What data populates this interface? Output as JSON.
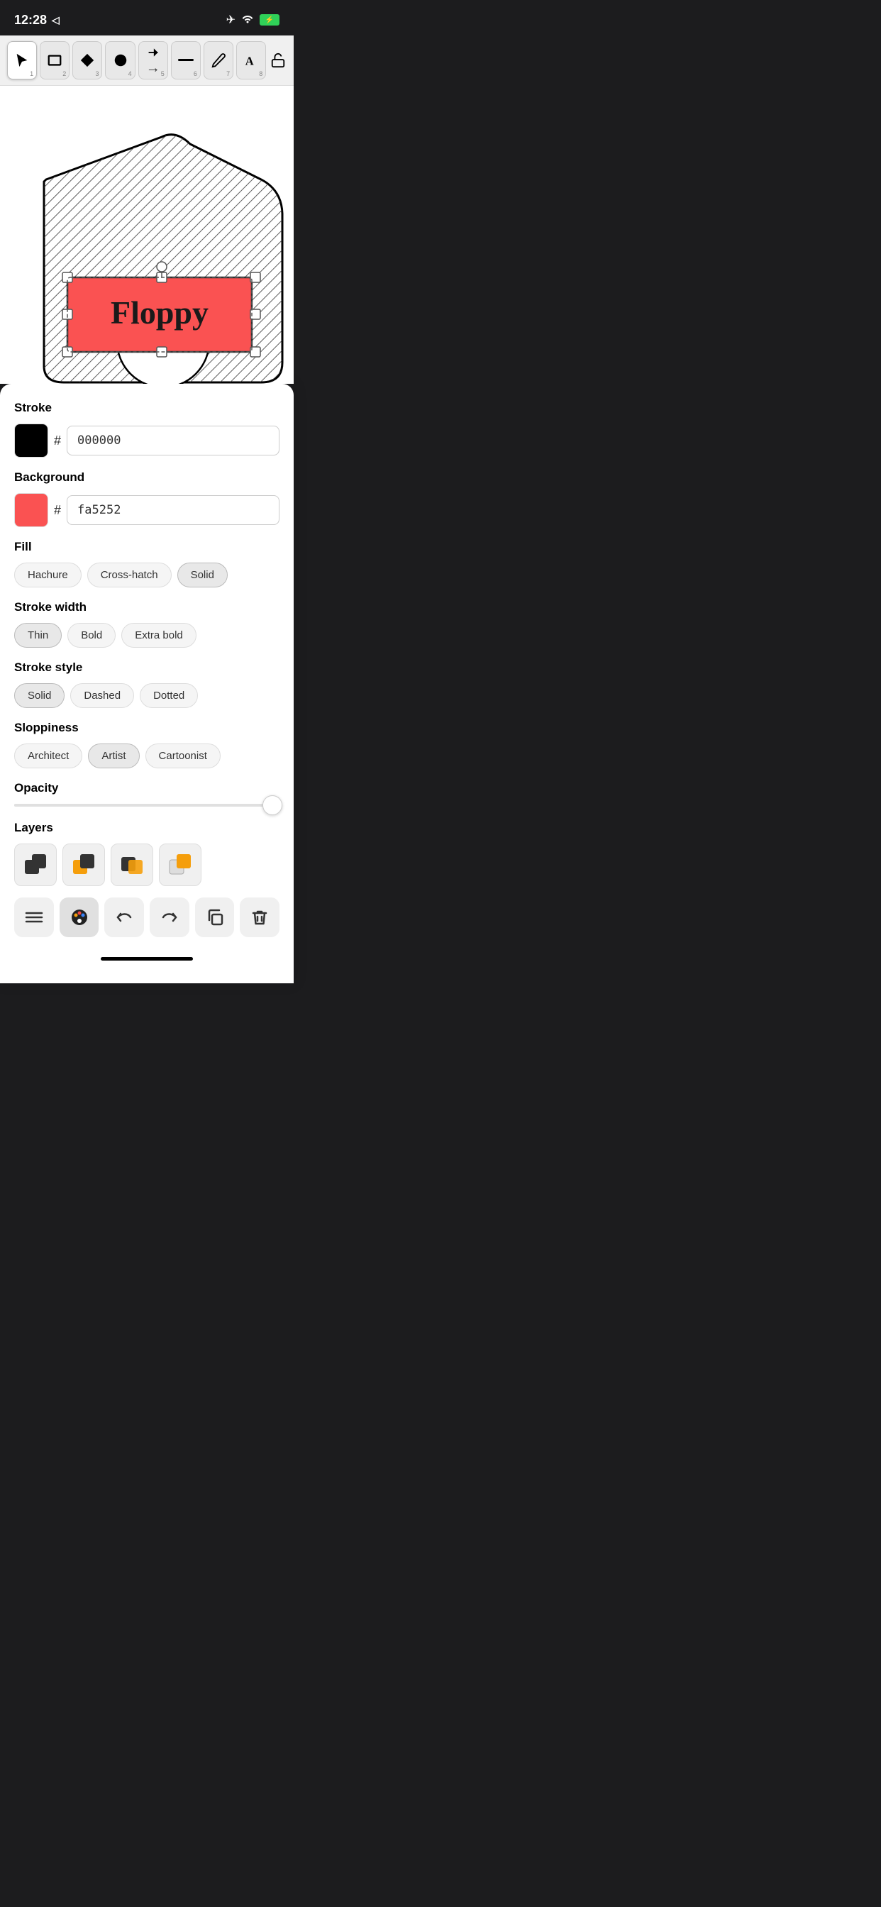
{
  "statusBar": {
    "time": "12:28",
    "locationArrow": "▶",
    "airplane": "✈",
    "wifi": "wifi",
    "battery": "⚡"
  },
  "toolbar": {
    "tools": [
      {
        "id": 1,
        "icon": "cursor",
        "label": "1",
        "active": true
      },
      {
        "id": 2,
        "icon": "rect",
        "label": "2",
        "active": false
      },
      {
        "id": 3,
        "icon": "diamond",
        "label": "3",
        "active": false
      },
      {
        "id": 4,
        "icon": "circle",
        "label": "4",
        "active": false
      },
      {
        "id": 5,
        "icon": "arrow",
        "label": "5",
        "active": false
      },
      {
        "id": 6,
        "icon": "line",
        "label": "6",
        "active": false
      },
      {
        "id": 7,
        "icon": "pencil",
        "label": "7",
        "active": false
      },
      {
        "id": 8,
        "icon": "text",
        "label": "8",
        "active": false
      }
    ],
    "lockIcon": "🔓"
  },
  "properties": {
    "strokeLabel": "Stroke",
    "strokeColor": "000000",
    "strokeSwatch": "#000000",
    "backgroundLabel": "Background",
    "backgroundColor": "fa5252",
    "backgroundSwatch": "#fa5252",
    "fillLabel": "Fill",
    "fillOptions": [
      "Hachure",
      "Cross-hatch",
      "Solid"
    ],
    "fillActive": "Solid",
    "strokeWidthLabel": "Stroke width",
    "strokeWidthOptions": [
      "Thin",
      "Bold",
      "Extra bold"
    ],
    "strokeWidthActive": "Thin",
    "strokeStyleLabel": "Stroke style",
    "strokeStyleOptions": [
      "Solid",
      "Dashed",
      "Dotted"
    ],
    "strokeStyleActive": "Solid",
    "sloppinessLabel": "Sloppiness",
    "sloppinessOptions": [
      "Architect",
      "Artist",
      "Cartoonist"
    ],
    "sloppinessActive": "Artist",
    "opacityLabel": "Opacity",
    "opacityValue": 95,
    "layersLabel": "Layers"
  },
  "bottomActions": {
    "menu": "≡",
    "palette": "🎨",
    "undo": "↩",
    "redo": "↪",
    "copy": "⧉",
    "trash": "🗑"
  },
  "canvasText": "Floppy"
}
